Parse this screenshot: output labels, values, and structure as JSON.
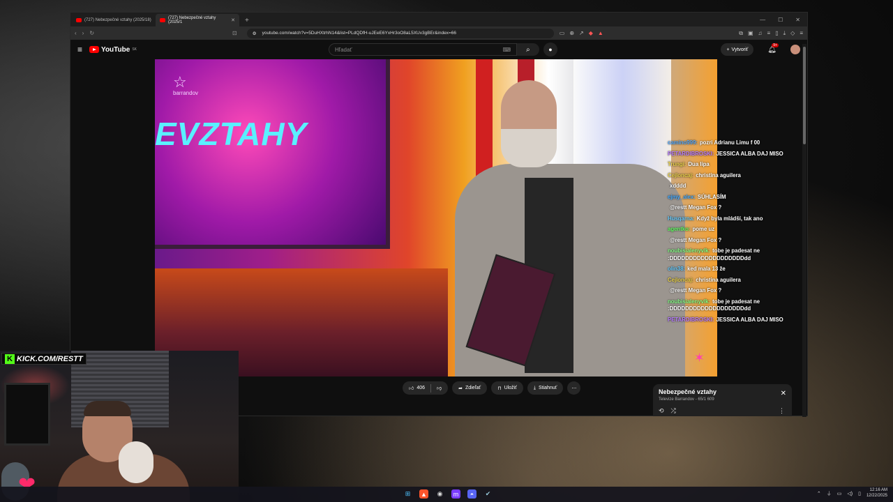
{
  "browser": {
    "tabs": [
      {
        "label": "(727) Nebezpečné vztahy (2025/18)",
        "active": false
      },
      {
        "label": "(727) Nebezpečné vztahy (2025/1",
        "active": true
      }
    ],
    "url": "youtube.com/watch?v=5DuHXtrhN14&list=PLdQDfH-uJEeE6YxHr3oO8aL5XUv3gBEr&index=66"
  },
  "youtube": {
    "logo_text": "YouTube",
    "region": "SK",
    "search_placeholder": "Hľadať",
    "create_label": "Vytvoriť",
    "notifications_badge": "9+"
  },
  "video": {
    "channel_brand": "barrandov",
    "screen_title": "EVZTAHY"
  },
  "chat": [
    {
      "user": "camino999:",
      "msg": "pozri Adrianu Limu f 00",
      "color": "#5af"
    },
    {
      "user": "PETARDIBROSKI:",
      "msg": "JESSICA ALBA DAJ MISO",
      "color": "#b77cff"
    },
    {
      "user": "Trungi:",
      "msg": "Dua lipa",
      "color": "#e8d04a"
    },
    {
      "user": "Cejloncaj:",
      "msg": "christina aguilera",
      "color": "#e8d04a"
    },
    {
      "user": "",
      "msg": "xdddd",
      "color": "#ff3a3a"
    },
    {
      "user": "ejmy_alex:",
      "msg": "SÚHLASÍM",
      "color": "#4af"
    },
    {
      "user": "",
      "msg": "@restt Megan Fox ?",
      "color": "#ff3a3a"
    },
    {
      "user": "Husqarna:",
      "msg": "Když byla mládší, tak ano",
      "color": "#6cf"
    },
    {
      "user": "agentko:",
      "msg": "pome uz",
      "color": "#6f6"
    },
    {
      "user": "",
      "msg": "@restt Megan Fox ?",
      "color": "#ff3a3a"
    },
    {
      "user": "noubisialenyvlk:",
      "msg": "tobe je padesat ne :DDDDDDDDDDDDDDDDDDDdd",
      "color": "#8f8"
    },
    {
      "user": "olin38:",
      "msg": "ked mala 13 že",
      "color": "#6cf"
    },
    {
      "user": "Cejloncaj:",
      "msg": "christina aguilera",
      "color": "#e8d04a"
    },
    {
      "user": "",
      "msg": "@restt Megan Fox ?",
      "color": "#ff3a3a"
    },
    {
      "user": "noubisialenyvlk:",
      "msg": "tobe je padesat ne :DDDDDDDDDDDDDDDDDDDdd",
      "color": "#8f8"
    },
    {
      "user": "PETARDIBROSKI:",
      "msg": "JESSICA ALBA DAJ MISO",
      "color": "#b77cff"
    }
  ],
  "actions": {
    "likes": "406",
    "share": "Zdieľať",
    "save": "Uložiť",
    "download": "Stiahnuť"
  },
  "playlist": {
    "title": "Nebezpečné vztahy",
    "subtitle": "Televize Barrandov - 65/1 609"
  },
  "overlay": {
    "kick_label": "KICK.COM/RESTT"
  },
  "taskbar": {
    "time": "12:16 AM",
    "date": "12/22/2025"
  }
}
